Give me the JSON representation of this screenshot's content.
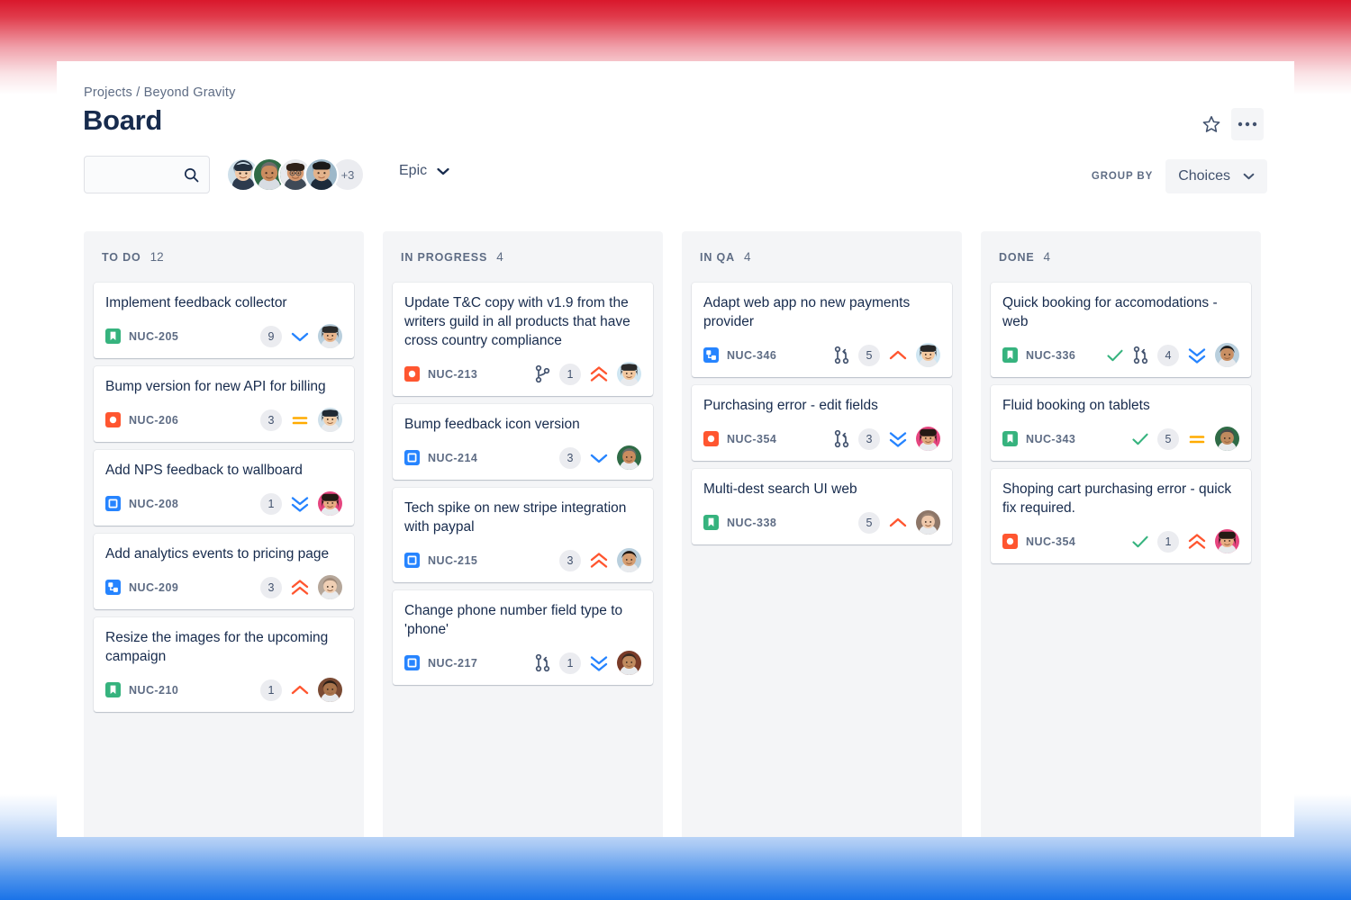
{
  "header": {
    "breadcrumb": "Projects / Beyond Gravity",
    "title": "Board",
    "star_icon": "star-icon",
    "more_icon": "more-options-icon"
  },
  "toolbar": {
    "search": {
      "value": "",
      "placeholder": "",
      "icon": "search-icon"
    },
    "avatars_overflow": "+3",
    "avatar_count": 4,
    "epic_label": "Epic",
    "epic_chevron": "chevron-down-icon",
    "group_by_label": "GROUP BY",
    "group_by_value": "Choices",
    "group_by_chevron": "chevron-down-icon"
  },
  "colors": {
    "story": "#36b37e",
    "bug": "#ff5630",
    "task": "#2684ff",
    "subtask": "#2684ff",
    "priority_high": "#ff5630",
    "priority_medium": "#ffab00",
    "priority_low": "#2684ff",
    "done_check": "#36b37e",
    "column_bg": "#f4f5f7",
    "text": "#172b4d",
    "subtle_text": "#5e6c84"
  },
  "columns": [
    {
      "name": "TO DO",
      "count": "12",
      "cards": [
        {
          "title": "Implement feedback collector",
          "key": "NUC-205",
          "type": "story",
          "dev": null,
          "done": false,
          "points": "9",
          "priority": "low",
          "avatar": "avatar-1"
        },
        {
          "title": "Bump version for new API for billing",
          "key": "NUC-206",
          "type": "bug",
          "dev": null,
          "done": false,
          "points": "3",
          "priority": "medium",
          "avatar": "avatar-2"
        },
        {
          "title": "Add NPS feedback to wallboard",
          "key": "NUC-208",
          "type": "task",
          "dev": null,
          "done": false,
          "points": "1",
          "priority": "lowest",
          "avatar": "avatar-3"
        },
        {
          "title": "Add analytics events to pricing page",
          "key": "NUC-209",
          "type": "subtask",
          "dev": null,
          "done": false,
          "points": "3",
          "priority": "highest",
          "avatar": "avatar-4"
        },
        {
          "title": "Resize the images for the upcoming campaign",
          "key": "NUC-210",
          "type": "story",
          "dev": null,
          "done": false,
          "points": "1",
          "priority": "high",
          "avatar": "avatar-5"
        }
      ]
    },
    {
      "name": "IN PROGRESS",
      "count": "4",
      "cards": [
        {
          "title": "Update T&C copy with v1.9 from the writers guild in all products that have cross country compliance",
          "key": "NUC-213",
          "type": "bug",
          "dev": "branch",
          "done": false,
          "points": "1",
          "priority": "highest",
          "avatar": "avatar-6"
        },
        {
          "title": "Bump feedback icon version",
          "key": "NUC-214",
          "type": "task",
          "dev": null,
          "done": false,
          "points": "3",
          "priority": "low",
          "avatar": "avatar-7"
        },
        {
          "title": "Tech spike on new stripe integration with paypal",
          "key": "NUC-215",
          "type": "task",
          "dev": null,
          "done": false,
          "points": "3",
          "priority": "highest",
          "avatar": "avatar-8"
        },
        {
          "title": "Change phone number field type to 'phone'",
          "key": "NUC-217",
          "type": "task",
          "dev": "pull-request",
          "done": false,
          "points": "1",
          "priority": "lowest",
          "avatar": "avatar-9"
        }
      ]
    },
    {
      "name": "IN QA",
      "count": "4",
      "cards": [
        {
          "title": "Adapt web app no new payments provider",
          "key": "NUC-346",
          "type": "subtask",
          "dev": "pull-request",
          "done": false,
          "points": "5",
          "priority": "high",
          "avatar": "avatar-10"
        },
        {
          "title": "Purchasing error - edit fields",
          "key": "NUC-354",
          "type": "bug",
          "dev": "pull-request",
          "done": false,
          "points": "3",
          "priority": "lowest",
          "avatar": "avatar-11"
        },
        {
          "title": "Multi-dest search UI web",
          "key": "NUC-338",
          "type": "story",
          "dev": null,
          "done": false,
          "points": "5",
          "priority": "high",
          "avatar": "avatar-12"
        }
      ]
    },
    {
      "name": "DONE",
      "count": "4",
      "cards": [
        {
          "title": "Quick booking for accomodations - web",
          "key": "NUC-336",
          "type": "story",
          "dev": "pull-request",
          "done": true,
          "points": "4",
          "priority": "lowest",
          "avatar": "avatar-13"
        },
        {
          "title": "Fluid booking on tablets",
          "key": "NUC-343",
          "type": "story",
          "dev": null,
          "done": true,
          "points": "5",
          "priority": "medium",
          "avatar": "avatar-14"
        },
        {
          "title": "Shoping cart purchasing error - quick fix required.",
          "key": "NUC-354",
          "type": "bug",
          "dev": null,
          "done": true,
          "points": "1",
          "priority": "highest",
          "avatar": "avatar-15"
        }
      ]
    }
  ]
}
